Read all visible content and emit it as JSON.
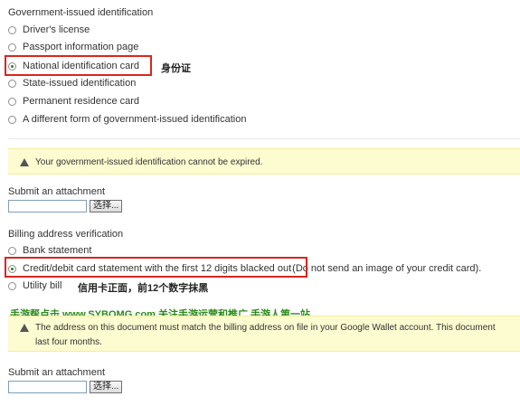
{
  "gov_id": {
    "title": "Government-issued identification",
    "options": [
      {
        "label": "Driver's license",
        "checked": false
      },
      {
        "label": "Passport information page",
        "checked": false
      },
      {
        "label": "National identification card",
        "checked": true
      },
      {
        "label": "State-issued identification",
        "checked": false
      },
      {
        "label": "Permanent residence card",
        "checked": false
      },
      {
        "label": "A different form of government-issued identification",
        "checked": false
      }
    ],
    "annotation": "身份证",
    "warning": "Your government-issued identification cannot be expired."
  },
  "attachment1": {
    "label": "Submit an attachment",
    "button_label": "选择..."
  },
  "billing": {
    "title": "Billing address verification",
    "options": [
      {
        "label": "Bank statement",
        "checked": false
      },
      {
        "label": "Credit/debit card statement with the first 12 digits blacked out",
        "checked": true,
        "suffix": "(Do not send an image of your credit card)."
      },
      {
        "label": "Utility bill",
        "checked": false
      }
    ],
    "annotation": "信用卡正面，前12个数字抹黑",
    "watermark": "手游帮点击 www.SYBOMG.com 关注手游运营和推广 手游人第一站",
    "warning_line1": "The address on this document must match the billing address on file in your Google Wallet account. This document",
    "warning_line2": "last four months."
  },
  "attachment2": {
    "label": "Submit an attachment",
    "button_label": "选择..."
  },
  "colors": {
    "highlight": "#d7261e",
    "warning_bg": "#fdfbd0",
    "watermark": "#2d8a17"
  }
}
